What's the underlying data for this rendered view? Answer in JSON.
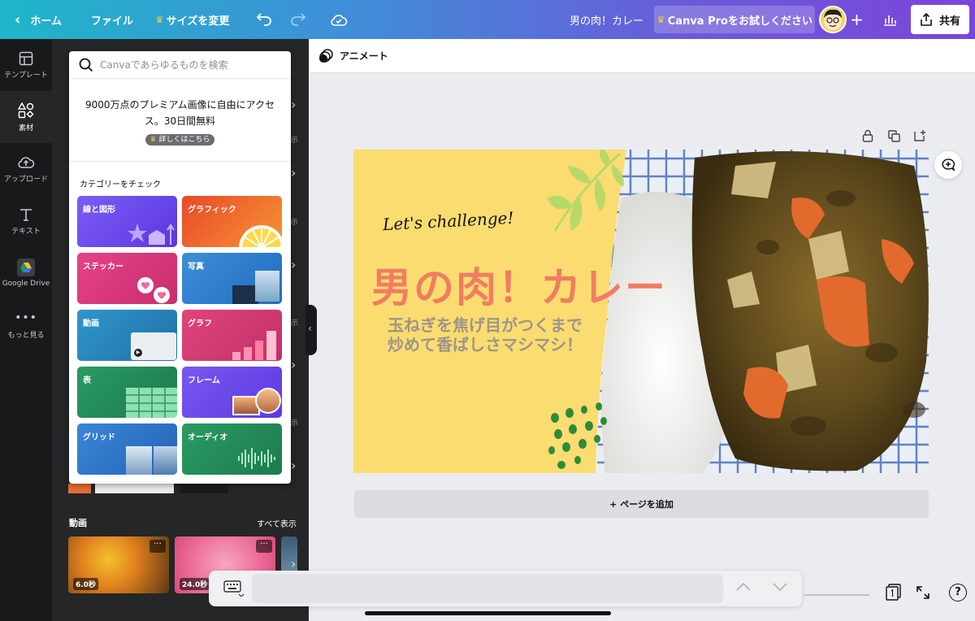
{
  "topbar": {
    "home_label": "ホーム",
    "file_label": "ファイル",
    "resize_label": "サイズを変更",
    "doc_title": "男の肉！カレー",
    "pro_label": "Canva Proをお試しください",
    "share_label": "共有"
  },
  "rail": {
    "items": [
      "テンプレート",
      "素材",
      "アップロード",
      "テキスト",
      "Google Drive",
      "もっと見る"
    ]
  },
  "popup": {
    "search_placeholder": "Canvaであらゆるものを検索",
    "promo_text": "9000万点のプレミアム画像に自由にアクセス。30日間無料",
    "promo_badge": "詳しくはこちら",
    "category_title": "カテゴリーをチェック",
    "categories": [
      "線と図形",
      "グラフィック",
      "ステッカー",
      "写真",
      "動画",
      "グラフ",
      "表",
      "フレーム",
      "グリッド",
      "オーディオ"
    ]
  },
  "panel": {
    "see_all_short": "示",
    "videos_title": "動画",
    "see_all": "すべて表示",
    "video_durations": [
      "6.0秒",
      "24.0秒"
    ]
  },
  "canvas": {
    "animate_label": "アニメート",
    "add_page_label": "+ ページを追加"
  },
  "design": {
    "tagline": "Let's challenge!",
    "title": "男の肉！カレー",
    "subtitle_line1": "玉ねぎを焦げ目がつくまで",
    "subtitle_line2": "炒めて香ばしさマシマシ！"
  },
  "colors": {
    "design_bg": "#fbdc70",
    "title_color": "#f07d62",
    "subtitle_color": "#9d958a",
    "accent_leaf": "#b8d96a",
    "dot_green": "#2f8b3a"
  }
}
